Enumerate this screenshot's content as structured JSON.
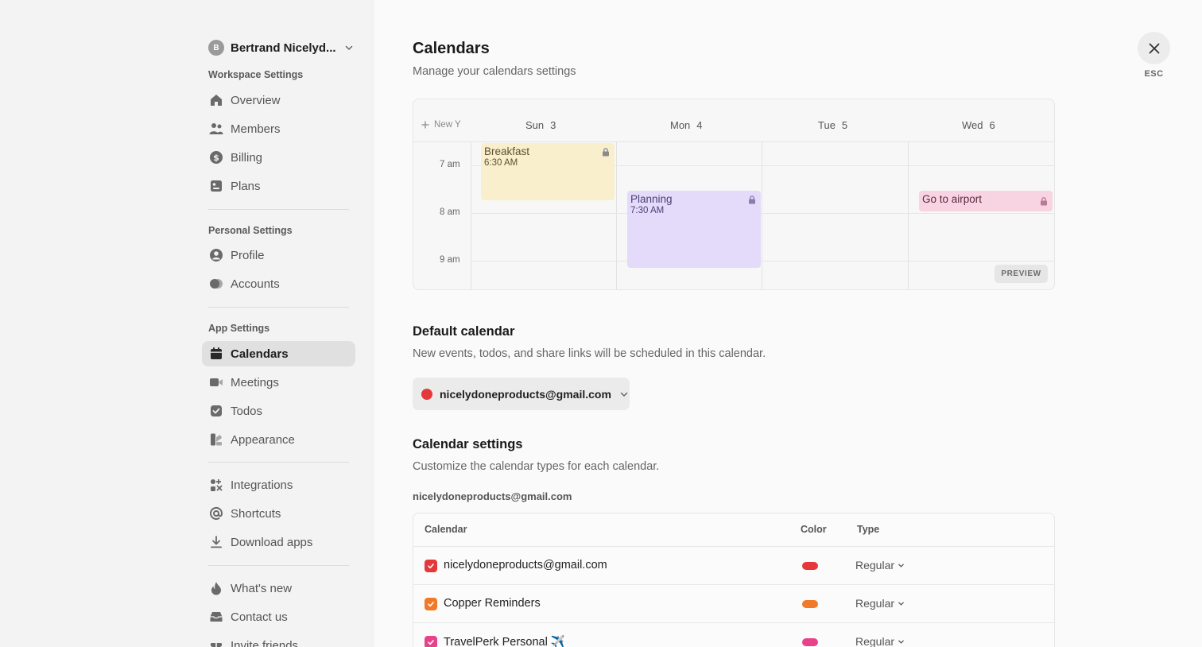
{
  "sidebar": {
    "account": {
      "initial": "B",
      "name": "Bertrand Nicelyd..."
    },
    "sections": {
      "workspace": "Workspace Settings",
      "personal": "Personal Settings",
      "app": "App Settings"
    },
    "items": {
      "overview": "Overview",
      "members": "Members",
      "billing": "Billing",
      "plans": "Plans",
      "profile": "Profile",
      "accounts": "Accounts",
      "calendars": "Calendars",
      "meetings": "Meetings",
      "todos": "Todos",
      "appearance": "Appearance",
      "integrations": "Integrations",
      "shortcuts": "Shortcuts",
      "download_apps": "Download apps",
      "whats_new": "What's new",
      "contact_us": "Contact us",
      "invite_friends": "Invite friends"
    },
    "active_item": "calendars"
  },
  "header": {
    "title": "Calendars",
    "subtitle": "Manage your calendars settings",
    "esc_label": "ESC"
  },
  "preview": {
    "new_label": "New Y",
    "days": [
      {
        "name": "Sun",
        "num": "3"
      },
      {
        "name": "Mon",
        "num": "4"
      },
      {
        "name": "Tue",
        "num": "5"
      },
      {
        "name": "Wed",
        "num": "6"
      }
    ],
    "hours": [
      "7 am",
      "8 am",
      "9 am"
    ],
    "events": {
      "breakfast": {
        "title": "Breakfast",
        "time": "6:30 AM",
        "bg": "#f9efcc",
        "fg": "#5e5230"
      },
      "planning": {
        "title": "Planning",
        "time": "7:30 AM",
        "bg": "#e4dafa",
        "fg": "#4d3f73"
      },
      "airport": {
        "title": "Go to airport",
        "bg": "#f8d3e2",
        "fg": "#5b2a3e"
      }
    },
    "badge": "PREVIEW"
  },
  "default_calendar": {
    "heading": "Default calendar",
    "description": "New events, todos, and share links will be scheduled in this calendar.",
    "selected": "nicelydoneproducts@gmail.com",
    "color": "#e5383b"
  },
  "calendar_settings": {
    "heading": "Calendar settings",
    "description": "Customize the calendar types for each calendar.",
    "account": "nicelydoneproducts@gmail.com",
    "columns": {
      "calendar": "Calendar",
      "color": "Color",
      "type": "Type"
    },
    "rows": [
      {
        "name": "nicelydoneproducts@gmail.com",
        "color": "#e5383b",
        "type": "Regular",
        "checked": true
      },
      {
        "name": "Copper Reminders",
        "color": "#f07a2a",
        "type": "Regular",
        "checked": true
      },
      {
        "name": "TravelPerk Personal ✈️",
        "color": "#e8428b",
        "type": "Regular",
        "checked": true
      }
    ]
  }
}
